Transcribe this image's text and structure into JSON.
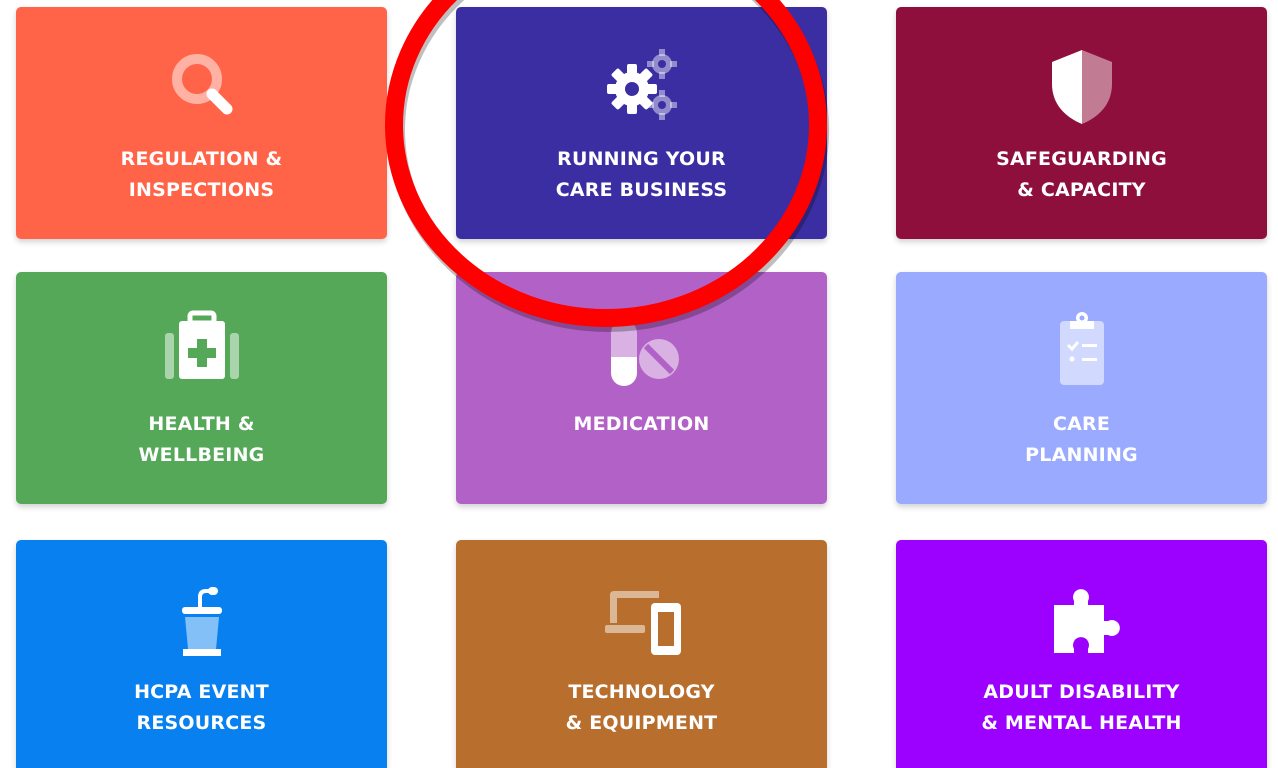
{
  "tiles": [
    {
      "id": "regulation",
      "line1": "REGULATION &",
      "line2": "INSPECTIONS",
      "color": "#ff6448",
      "icon": "magnifier-icon"
    },
    {
      "id": "running",
      "line1": "RUNNING YOUR",
      "line2": "CARE BUSINESS",
      "color": "#3b2ea3",
      "icon": "gears-icon"
    },
    {
      "id": "safeguarding",
      "line1": "SAFEGUARDING",
      "line2": "& CAPACITY",
      "color": "#8e0f3b",
      "icon": "shield-icon"
    },
    {
      "id": "health",
      "line1": "HEALTH &",
      "line2": "WELLBEING",
      "color": "#55a858",
      "icon": "medical-kit-icon"
    },
    {
      "id": "medication",
      "line1": "MEDICATION",
      "line2": "",
      "color": "#b262c6",
      "icon": "pills-icon"
    },
    {
      "id": "care-planning",
      "line1": "CARE",
      "line2": "PLANNING",
      "color": "#9aaaff",
      "icon": "clipboard-checklist-icon"
    },
    {
      "id": "events",
      "line1": "HCPA EVENT",
      "line2": "RESOURCES",
      "color": "#0880f0",
      "icon": "lectern-icon"
    },
    {
      "id": "technology",
      "line1": "TECHNOLOGY",
      "line2": "& EQUIPMENT",
      "color": "#b86e2d",
      "icon": "devices-icon"
    },
    {
      "id": "disability",
      "line1": "ADULT DISABILITY",
      "line2": "& MENTAL HEALTH",
      "color": "#9c00ff",
      "icon": "puzzle-piece-icon"
    }
  ],
  "annotation": {
    "shape": "circle",
    "color": "#ff0000",
    "target": "RUNNING YOUR CARE BUSINESS"
  }
}
